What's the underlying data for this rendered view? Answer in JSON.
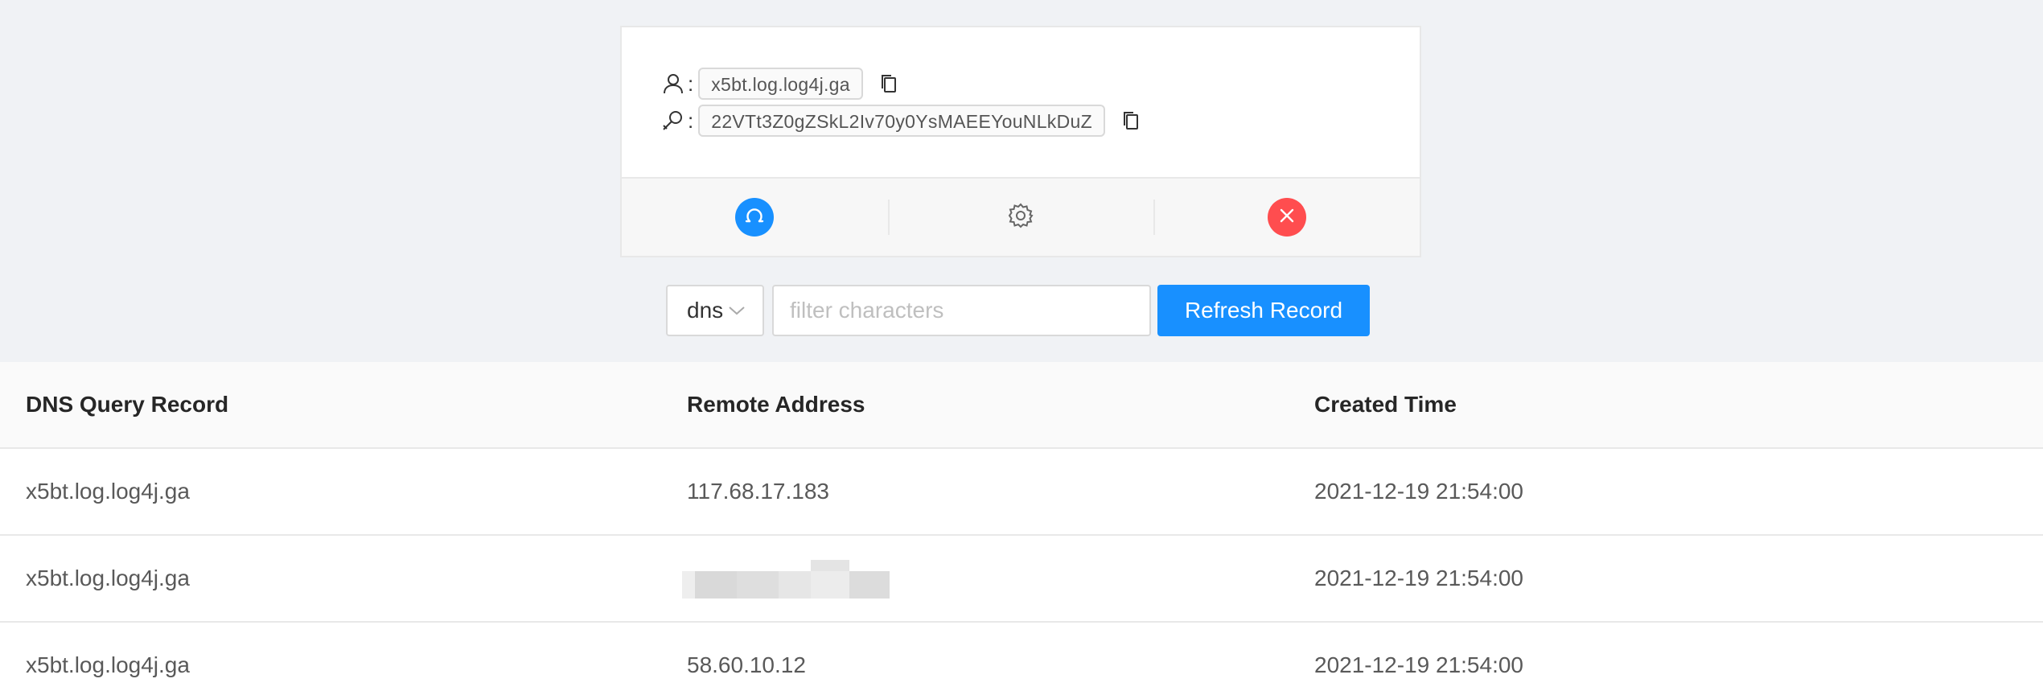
{
  "credentials": {
    "domain": "x5bt.log.log4j.ga",
    "token": "22VTt3Z0gZSkL2Iv70y0YsMAEEYouNLkDuZ",
    "colon": ":",
    "domain_icon": "user-icon",
    "token_icon": "search-key-icon",
    "copy_icon": "copy-icon"
  },
  "actions": [
    {
      "name": "reload-button",
      "icon": "reload-icon",
      "color": "#1890ff"
    },
    {
      "name": "settings-button",
      "icon": "gear-icon",
      "color": "#8c8c8c"
    },
    {
      "name": "close-button",
      "icon": "close-icon",
      "color": "#ff4d4f"
    }
  ],
  "filter": {
    "type_value": "dns",
    "placeholder": "filter characters",
    "refresh_label": "Refresh Record"
  },
  "table": {
    "headers": [
      "DNS Query Record",
      "Remote Address",
      "Created Time"
    ],
    "rows": [
      {
        "record": "x5bt.log.log4j.ga",
        "address": "117.68.17.183",
        "time": "2021-12-19 21:54:00"
      },
      {
        "record": "x5bt.log.log4j.ga",
        "address": "",
        "time": "2021-12-19 21:54:00"
      },
      {
        "record": "x5bt.log.log4j.ga",
        "address": "58.60.10.12",
        "time": "2021-12-19 21:54:00"
      }
    ]
  },
  "colors": {
    "primary": "#1890ff",
    "danger": "#ff4d4f",
    "background": "#f0f2f5"
  }
}
